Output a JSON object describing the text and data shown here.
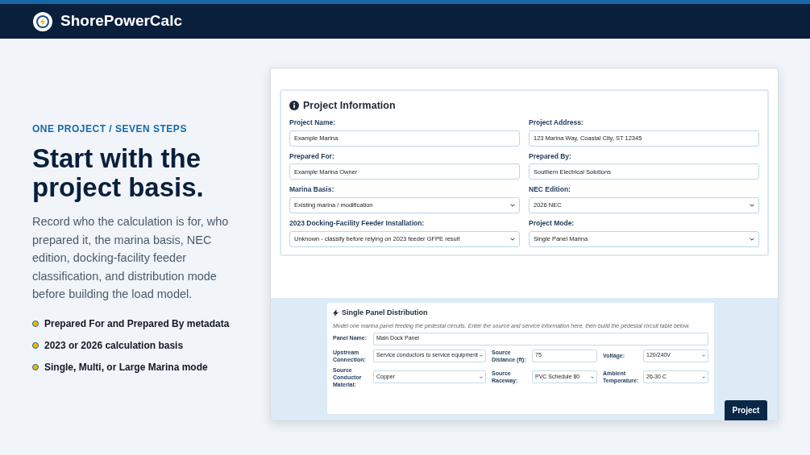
{
  "header": {
    "brand": "ShorePowerCalc"
  },
  "intro": {
    "eyebrow": "ONE PROJECT / SEVEN STEPS",
    "heading": "Start with the project basis.",
    "description": "Record who the calculation is for, who prepared it, the marina basis, NEC edition, docking-facility feeder classification, and distribution mode before building the load model.",
    "bullets": [
      "Prepared For and Prepared By metadata",
      "2023 or 2026 calculation basis",
      "Single, Multi, or Large Marina mode"
    ]
  },
  "project_information": {
    "title": "Project Information",
    "fields": [
      {
        "label": "Project Name:",
        "kind": "input",
        "value": "Example Marina"
      },
      {
        "label": "Project Address:",
        "kind": "input",
        "value": "123 Marina Way, Coastal City, ST 12345"
      },
      {
        "label": "Prepared For:",
        "kind": "input",
        "value": "Example Marina Owner"
      },
      {
        "label": "Prepared By:",
        "kind": "input",
        "value": "Southern Electrical Solutions"
      },
      {
        "label": "Marina Basis:",
        "kind": "select",
        "value": "Existing marina / modification"
      },
      {
        "label": "NEC Edition:",
        "kind": "select",
        "value": "2026 NEC"
      },
      {
        "label": "2023 Docking-Facility Feeder Installation:",
        "kind": "select",
        "value": "Unknown - classify before relying on 2023 feeder GFPE result"
      },
      {
        "label": "Project Mode:",
        "kind": "select",
        "value": "Single Panel Marina"
      }
    ]
  },
  "distribution": {
    "title": "Single Panel Distribution",
    "description": "Model one marina panel feeding the pedestal circuits. Enter the source and service information here, then build the pedestal circuit table below.",
    "panel_name": {
      "label": "Panel Name:",
      "value": "Main Dock Panel"
    },
    "fields": [
      {
        "label": "Upstream Connection:",
        "kind": "select",
        "value": "Service conductors to service equipment"
      },
      {
        "label": "Source Distance (ft):",
        "kind": "input",
        "value": "75"
      },
      {
        "label": "Voltage:",
        "kind": "select",
        "value": "120/240V"
      },
      {
        "label": "Source Conductor Material:",
        "kind": "select",
        "value": "Copper"
      },
      {
        "label": "Source Raceway:",
        "kind": "select",
        "value": "PVC Schedule 80"
      },
      {
        "label": "Ambient Temperature:",
        "kind": "select",
        "value": "26-30 C"
      }
    ]
  },
  "project_button": "Project"
}
